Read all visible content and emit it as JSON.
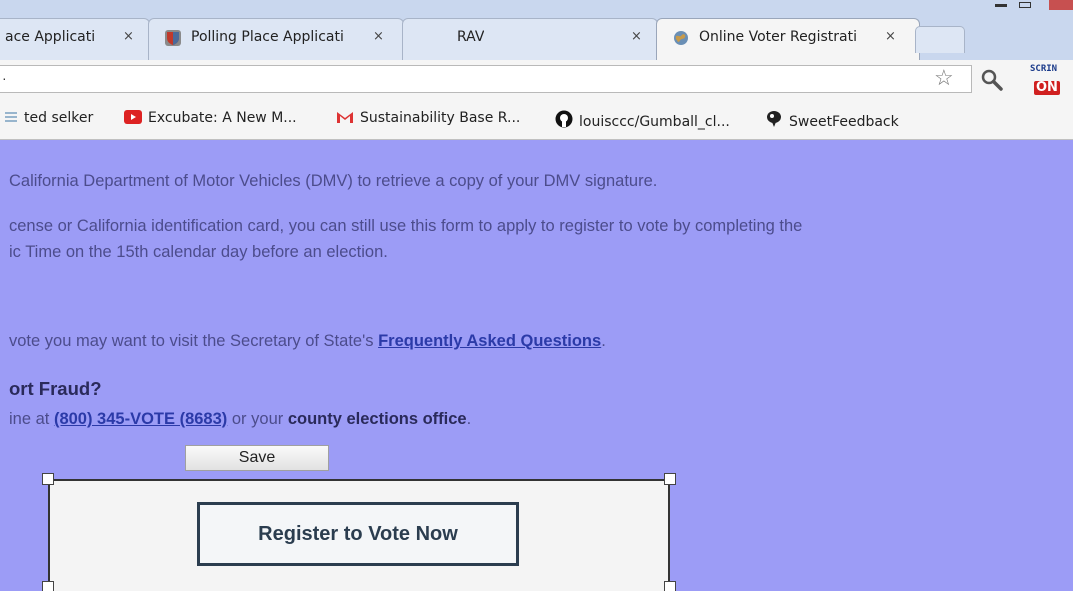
{
  "browser": {
    "tabs": [
      {
        "title": "ace Applicati",
        "close": "×"
      },
      {
        "title": "Polling Place Applicati",
        "close": "×"
      },
      {
        "title": "RAV",
        "close": "×"
      },
      {
        "title": "Online Voter Registrati",
        "close": "×",
        "active": true
      }
    ],
    "address": "·",
    "scrin_label": "SCRIN",
    "scrin_on": "ON",
    "bookmarks": [
      {
        "label": "ted selker",
        "icon": "list-icon"
      },
      {
        "label": "Excubate: A New M...",
        "icon": "youtube-icon"
      },
      {
        "label": "Sustainability Base R...",
        "icon": "gmail-icon"
      },
      {
        "label": "louisccc/Gumball_cl...",
        "icon": "github-icon"
      },
      {
        "label": "SweetFeedback",
        "icon": "feedback-icon"
      }
    ]
  },
  "page": {
    "line1": "California Department of Motor Vehicles (DMV) to retrieve a copy of your DMV signature.",
    "line2": "cense or California identification card, you can still use this form to apply to register to vote by completing the",
    "line3": "ic Time on the 15th calendar day before an election.",
    "line4_text": "vote you may want to visit the Secretary of State's ",
    "line4_link": "Frequently Asked Questions",
    "line4_end": ".",
    "fraud_heading": "ort Fraud?",
    "line5_text": "ine at ",
    "line5_link": "(800) 345-VOTE (8683)",
    "line5_mid": " or your ",
    "line5_bold": "county elections office",
    "line5_end": ".",
    "save_label": "Save",
    "register_label": "Register to Vote Now"
  }
}
